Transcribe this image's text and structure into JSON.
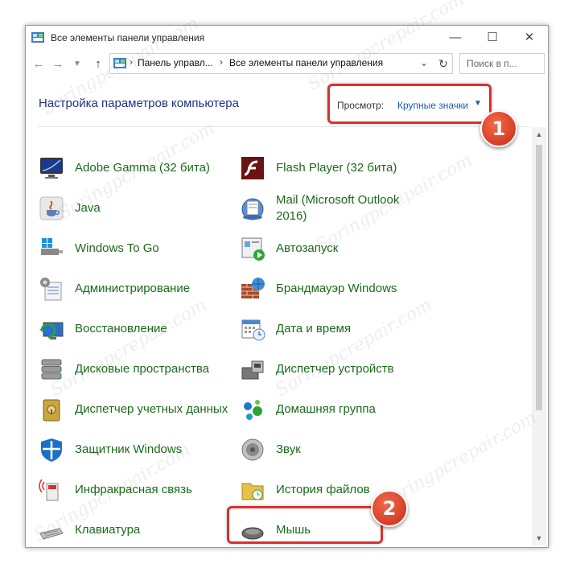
{
  "window": {
    "title": "Все элементы панели управления"
  },
  "address": {
    "crumbs": [
      "Панель управл...",
      "Все элементы панели управления"
    ],
    "search_placeholder": "Поиск в п..."
  },
  "header": {
    "title": "Настройка параметров компьютера",
    "view_label": "Просмотр:",
    "view_value": "Крупные значки"
  },
  "items_left": [
    "Adobe Gamma (32 бита)",
    "Java",
    "Windows To Go",
    "Администрирование",
    "Восстановление",
    "Дисковые пространства",
    "Диспетчер учетных данных",
    "Защитник Windows",
    "Инфракрасная связь",
    "Клавиатура"
  ],
  "items_right": [
    "Flash Player (32 бита)",
    "Mail (Microsoft Outlook 2016)",
    "Автозапуск",
    "Брандмауэр Windows",
    "Дата и время",
    "Диспетчер устройств",
    "Домашняя группа",
    "Звук",
    "История файлов",
    "Мышь"
  ],
  "badges": [
    "1",
    "2"
  ],
  "watermark": "Soringpcrepair.com",
  "colors": {
    "link": "#1a6b1a",
    "heading": "#1e3287",
    "callout": "#d93030"
  }
}
